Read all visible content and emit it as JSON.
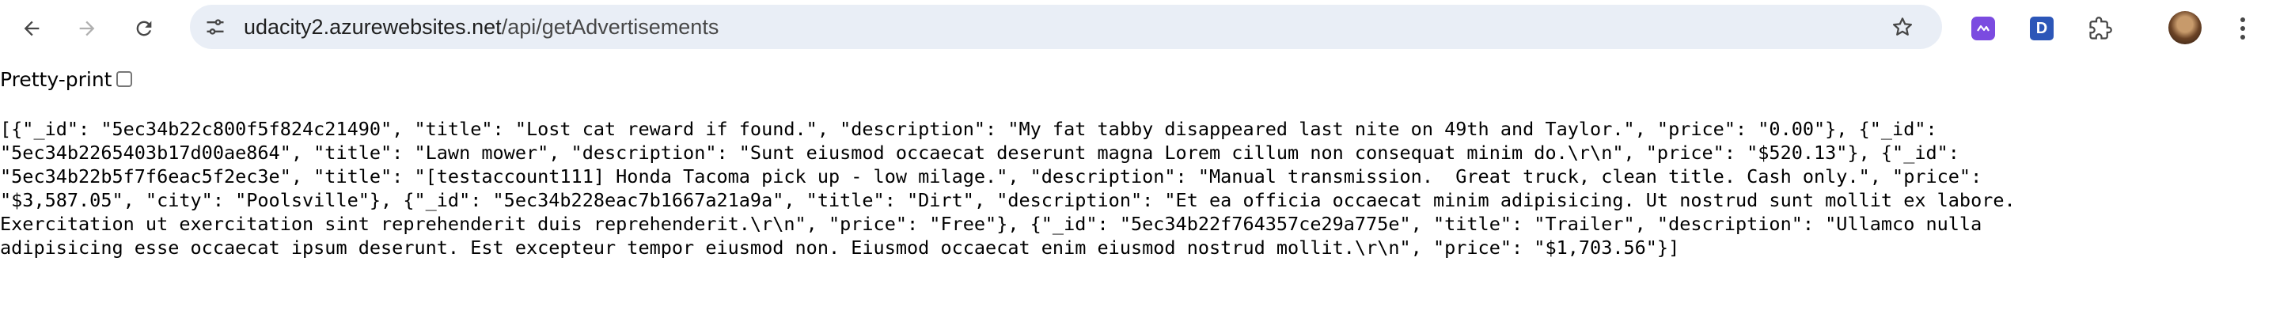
{
  "browser": {
    "url_host": "udacity2.azurewebsites.net",
    "url_path": "/api/getAdvertisements",
    "extensions": [
      "purple-extension-icon",
      "D"
    ]
  },
  "viewer": {
    "pretty_print_label": "Pretty-print",
    "pretty_print_checked": false
  },
  "json_lines": [
    "[{\"_id\": \"5ec34b22c800f5f824c21490\", \"title\": \"Lost cat reward if found.\", \"description\": \"My fat tabby disappeared last nite on 49th and Taylor.\", \"price\": \"0.00\"}, {\"_id\":",
    "\"5ec34b2265403b17d00ae864\", \"title\": \"Lawn mower\", \"description\": \"Sunt eiusmod occaecat deserunt magna Lorem cillum non consequat minim do.\\r\\n\", \"price\": \"$520.13\"}, {\"_id\":",
    "\"5ec34b22b5f7f6eac5f2ec3e\", \"title\": \"[testaccount111] Honda Tacoma pick up - low milage.\", \"description\": \"Manual transmission.  Great truck, clean title. Cash only.\", \"price\":",
    "\"$3,587.05\", \"city\": \"Poolsville\"}, {\"_id\": \"5ec34b228eac7b1667a21a9a\", \"title\": \"Dirt\", \"description\": \"Et ea officia occaecat minim adipisicing. Ut nostrud sunt mollit ex labore.",
    "Exercitation ut exercitation sint reprehenderit duis reprehenderit.\\r\\n\", \"price\": \"Free\"}, {\"_id\": \"5ec34b22f764357ce29a775e\", \"title\": \"Trailer\", \"description\": \"Ullamco nulla",
    "adipisicing esse occaecat ipsum deserunt. Est excepteur tempor eiusmod non. Eiusmod occaecat enim eiusmod nostrud mollit.\\r\\n\", \"price\": \"$1,703.56\"}]"
  ]
}
